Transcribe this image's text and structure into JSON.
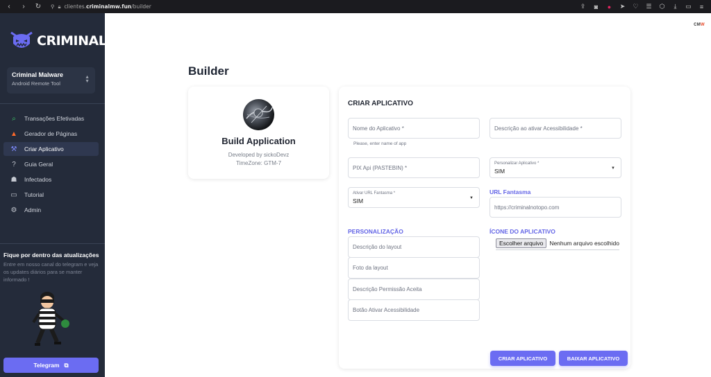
{
  "browser": {
    "url_prefix": "clientes.",
    "url_domain": "criminalmw.fun",
    "url_path": "/builder"
  },
  "sidebar": {
    "brand": "CRIMINAL",
    "app_select": {
      "title": "Criminal Malware",
      "subtitle": "Android Remote Tool"
    },
    "menu": [
      {
        "label": "Transações Efetivadas",
        "icon": "money-search-icon"
      },
      {
        "label": "Gerador de Páginas",
        "icon": "fire-icon"
      },
      {
        "label": "Criar Aplicativo",
        "icon": "build-icon",
        "active": true
      },
      {
        "label": "Guia Geral",
        "icon": "help-circle-icon"
      },
      {
        "label": "Infectados",
        "icon": "android-icon"
      },
      {
        "label": "Tutorial",
        "icon": "monitor-icon"
      },
      {
        "label": "Admin",
        "icon": "gear-icon"
      }
    ],
    "news": {
      "heading": "Fique por dentro das atualizações",
      "body": "Entre em nosso canal do telegram e veja os updates diários para se manter informado !"
    },
    "telegram_label": "Telegram"
  },
  "header": {
    "badge_left": "CM",
    "badge_right": "W",
    "page_title": "Builder"
  },
  "profile": {
    "name": "Build Application",
    "developer": "Developed by sickoDevz",
    "timezone": "TimeZone: GTM-7"
  },
  "form": {
    "title": "CRIAR APLICATIVO",
    "app_name_placeholder": "Nome do Aplicativo *",
    "app_name_hint": "Please, enter name of app",
    "accessibility_desc_placeholder": "Descrição ao ativar Acessibilidade *",
    "pix_api_placeholder": "PIX Api (PASTEBIN) *",
    "customize_app": {
      "label": "Personalizar Aplicativo *",
      "value": "SIM"
    },
    "activate_phantom_url": {
      "label": "Ativar URL Fantasma *",
      "value": "SIM"
    },
    "phantom_url_section": "URL Fantasma",
    "phantom_url_placeholder": "https://criminalnotopo.com",
    "personalization_section": "PERSONALIZAÇÃO",
    "layout_desc_placeholder": "Descrição do layout",
    "layout_photo_placeholder": "Foto da layout",
    "permission_desc_placeholder": "Descrição Permissão Aceita",
    "accessibility_button_placeholder": "Botão Ativar Acessibilidade",
    "app_icon_section": "ÍCONE DO APLICATIVO",
    "file_button": "Escolher arquivo",
    "file_status": "Nenhum arquivo escolhido",
    "create_button": "CRIAR APLICATIVO",
    "download_button": "BAIXAR APLICATIVO"
  },
  "colors": {
    "sidebar_bg": "#242b3a",
    "accent": "#6b6cf2",
    "section_title": "#6264e6"
  }
}
